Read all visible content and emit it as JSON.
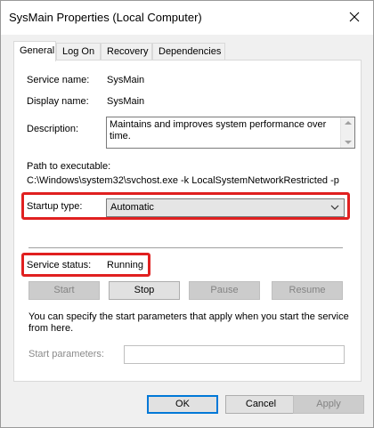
{
  "window": {
    "title": "SysMain Properties (Local Computer)"
  },
  "tabs": [
    {
      "label": "General",
      "active": true
    },
    {
      "label": "Log On",
      "active": false
    },
    {
      "label": "Recovery",
      "active": false
    },
    {
      "label": "Dependencies",
      "active": false
    }
  ],
  "general": {
    "service_name_label": "Service name:",
    "service_name_value": "SysMain",
    "display_name_label": "Display name:",
    "display_name_value": "SysMain",
    "description_label": "Description:",
    "description_value": "Maintains and improves system performance over time.",
    "path_label": "Path to executable:",
    "path_value": "C:\\Windows\\system32\\svchost.exe -k LocalSystemNetworkRestricted -p",
    "startup_type_label": "Startup type:",
    "startup_type_value": "Automatic",
    "service_status_label": "Service status:",
    "service_status_value": "Running",
    "buttons": {
      "start": "Start",
      "stop": "Stop",
      "pause": "Pause",
      "resume": "Resume"
    },
    "info_text": "You can specify the start parameters that apply when you start the service from here.",
    "start_params_label": "Start parameters:",
    "start_params_value": ""
  },
  "footer": {
    "ok": "OK",
    "cancel": "Cancel",
    "apply": "Apply"
  },
  "colors": {
    "highlight": "#e02020",
    "accent": "#0078d7"
  }
}
